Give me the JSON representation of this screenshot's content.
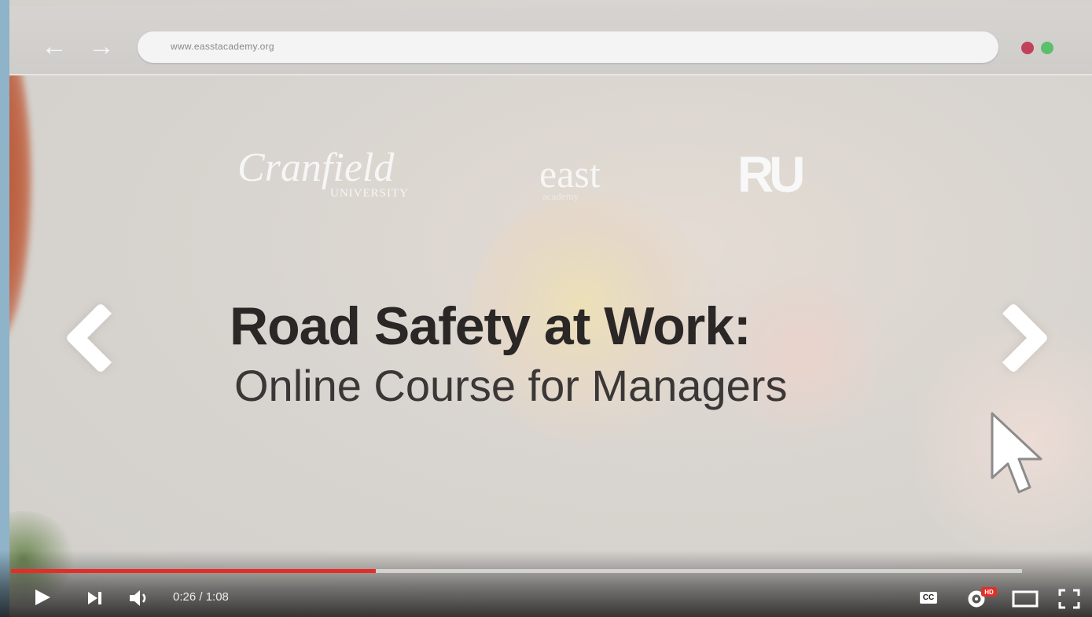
{
  "browser": {
    "back_label": "←",
    "forward_label": "→",
    "url": "www.easstacademy.org"
  },
  "logos": {
    "cranfield_main": "Cranfield",
    "cranfield_sub": "UNIVERSITY",
    "east_main": "east",
    "east_sub": "academy",
    "ru": "RU"
  },
  "slide": {
    "title": "Road Safety at Work:",
    "subtitle": "Online Course for Managers"
  },
  "player": {
    "time": "0:26 / 1:08",
    "progress": 0.3611,
    "cc_label": "CC",
    "hd_badge": "HD",
    "progress_color": "#e52d27"
  },
  "colors": {
    "dot_red": "#c0425a",
    "dot_green": "#5cbf6c"
  }
}
